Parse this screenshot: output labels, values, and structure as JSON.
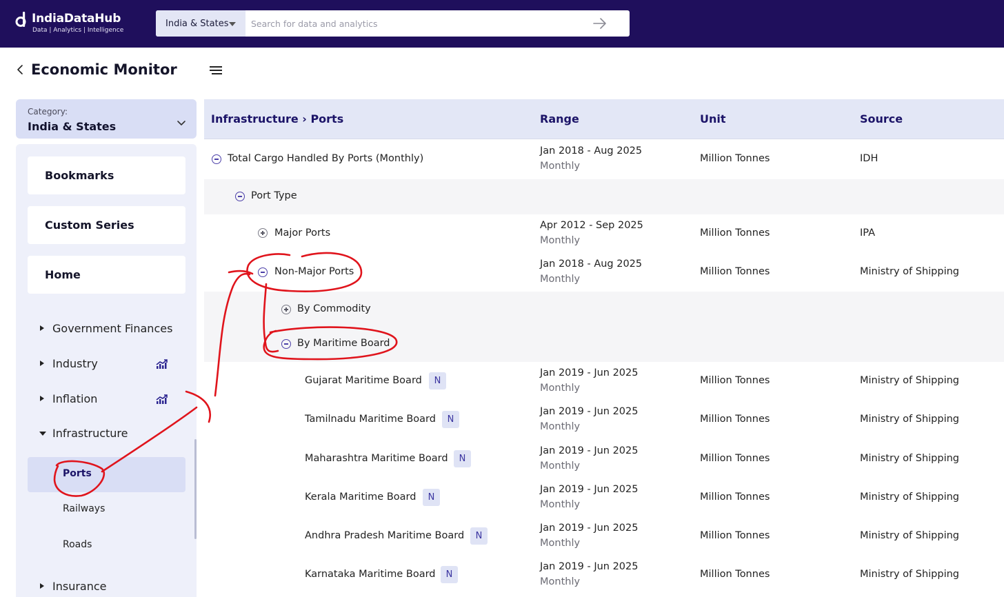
{
  "header": {
    "logo_title": "IndiaDataHub",
    "logo_subtitle": "Data | Analytics | Intelligence",
    "scope_select": "India & States",
    "search_placeholder": "Search for data and analytics"
  },
  "page": {
    "title": "Economic Monitor"
  },
  "category": {
    "label": "Category:",
    "value": "India & States"
  },
  "sidebar": {
    "cards": [
      "Bookmarks",
      "Custom Series",
      "Home"
    ],
    "tree": [
      {
        "label": "Government Finances",
        "expanded": false,
        "trend_icon": false
      },
      {
        "label": "Industry",
        "expanded": false,
        "trend_icon": true
      },
      {
        "label": "Inflation",
        "expanded": false,
        "trend_icon": true
      },
      {
        "label": "Infrastructure",
        "expanded": true,
        "trend_icon": false
      },
      {
        "label": "Insurance",
        "expanded": false,
        "trend_icon": false
      }
    ],
    "infrastructure_children": [
      "Ports",
      "Railways",
      "Roads"
    ],
    "active_child": "Ports"
  },
  "table": {
    "breadcrumb": "Infrastructure › Ports",
    "columns": {
      "range": "Range",
      "unit": "Unit",
      "source": "Source"
    },
    "rows": [
      {
        "name": "Total Cargo Handled By Ports (Monthly)",
        "toggle": "minus",
        "range": "Jan 2018 - Aug 2025",
        "frequency": "Monthly",
        "unit": "Million Tonnes",
        "source": "IDH"
      },
      {
        "name": "Port Type",
        "toggle": "minus"
      },
      {
        "name": "Major Ports",
        "toggle": "plus",
        "range": "Apr 2012 - Sep 2025",
        "frequency": "Monthly",
        "unit": "Million Tonnes",
        "source": "IPA"
      },
      {
        "name": "Non-Major Ports",
        "toggle": "minus",
        "range": "Jan 2018 - Aug 2025",
        "frequency": "Monthly",
        "unit": "Million Tonnes",
        "source": "Ministry of Shipping"
      },
      {
        "name": "By Commodity",
        "toggle": "plus"
      },
      {
        "name": "By Maritime Board",
        "toggle": "minus"
      },
      {
        "name": "Gujarat Maritime Board",
        "badge": "N",
        "range": "Jan 2019 - Jun 2025",
        "frequency": "Monthly",
        "unit": "Million Tonnes",
        "source": "Ministry of Shipping"
      },
      {
        "name": "Tamilnadu Maritime Board",
        "badge": "N",
        "range": "Jan 2019 - Jun 2025",
        "frequency": "Monthly",
        "unit": "Million Tonnes",
        "source": "Ministry of Shipping"
      },
      {
        "name": "Maharashtra Maritime Board",
        "badge": "N",
        "range": "Jan 2019 - Jun 2025",
        "frequency": "Monthly",
        "unit": "Million Tonnes",
        "source": "Ministry of Shipping"
      },
      {
        "name": "Kerala Maritime Board",
        "badge": "N",
        "range": "Jan 2019 - Jun 2025",
        "frequency": "Monthly",
        "unit": "Million Tonnes",
        "source": "Ministry of Shipping"
      },
      {
        "name": "Andhra Pradesh Maritime Board",
        "badge": "N",
        "range": "Jan 2019 - Jun 2025",
        "frequency": "Monthly",
        "unit": "Million Tonnes",
        "source": "Ministry of Shipping"
      },
      {
        "name": "Karnataka Maritime Board",
        "badge": "N",
        "range": "Jan 2019 - Jun 2025",
        "frequency": "Monthly",
        "unit": "Million Tonnes",
        "source": "Ministry of Shipping"
      }
    ]
  },
  "colors": {
    "topbar": "#1f0f5c",
    "accent": "#1c1468",
    "annotation": "#e0141c"
  }
}
